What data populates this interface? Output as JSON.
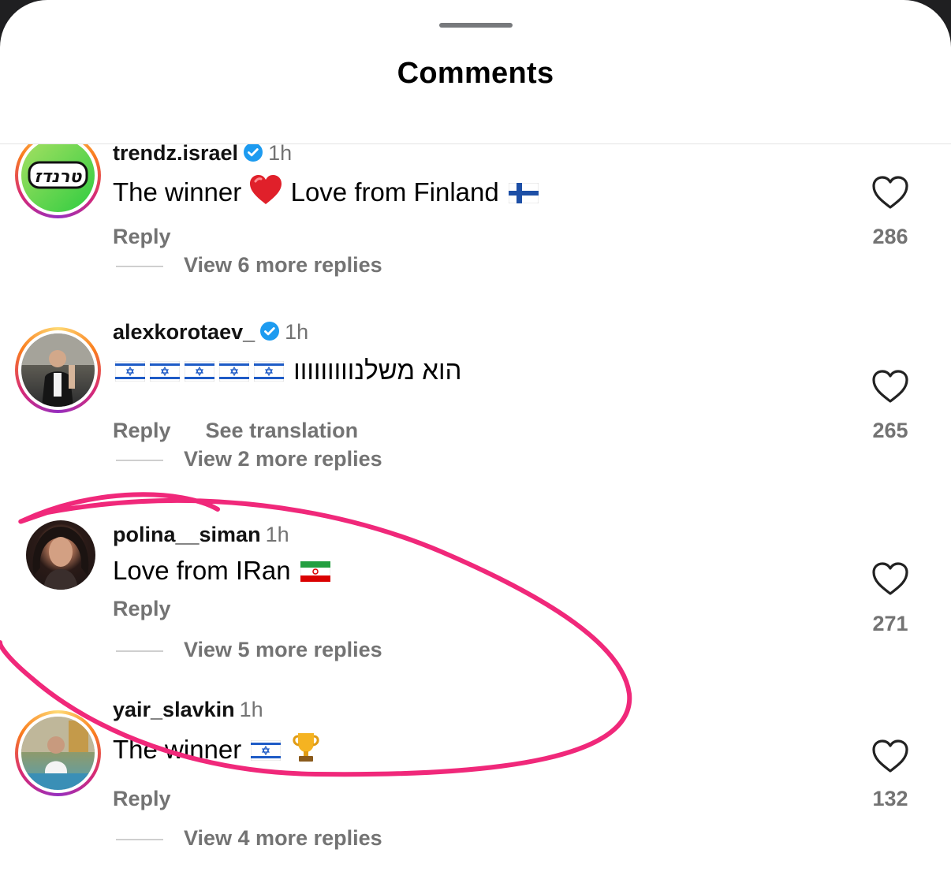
{
  "sheet": {
    "title": "Comments"
  },
  "comments": [
    {
      "username": "trendz.israel",
      "verified": true,
      "time": "1h",
      "text_before": "The winner",
      "text_after": "Love from Finland",
      "reply_label": "Reply",
      "view_replies": "View 6 more replies",
      "likes": "286",
      "avatar_logo_text": "טרנדז"
    },
    {
      "username": "alexkorotaev_",
      "verified": true,
      "time": "1h",
      "text": "הוא משלנווווווווו",
      "reply_label": "Reply",
      "translation_label": "See translation",
      "view_replies": "View 2 more replies",
      "likes": "265"
    },
    {
      "username": "polina__siman",
      "verified": false,
      "time": "1h",
      "text": "Love from IRan",
      "reply_label": "Reply",
      "view_replies": "View 5 more replies",
      "likes": "271"
    },
    {
      "username": "yair_slavkin",
      "verified": false,
      "time": "1h",
      "text": "The winner",
      "reply_label": "Reply",
      "view_replies": "View 4 more replies",
      "likes": "132"
    }
  ],
  "icons": {
    "like": "heart-outline-icon",
    "verified": "verified-badge-icon",
    "grab": "drag-handle"
  },
  "colors": {
    "annotation": "#f0287a",
    "muted_text": "#737373",
    "verified": "#1d9bf0"
  }
}
